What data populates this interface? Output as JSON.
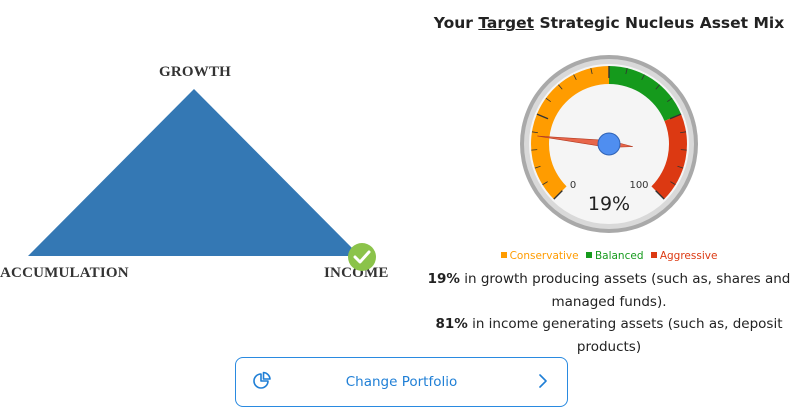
{
  "triangle": {
    "top_label": "GROWTH",
    "left_label": "ACCUMULATION",
    "right_label": "INCOME",
    "fill_color": "#3478b4",
    "selected": "INCOME",
    "check_color": "#8bc34a"
  },
  "title": {
    "prefix": "Your",
    "emphasis": "Target",
    "suffix": "Strategic Nucleus Asset Mix"
  },
  "gauge": {
    "value": 19,
    "display": "19%",
    "min_label": "0",
    "max_label": "100",
    "bands": [
      {
        "name": "Conservative",
        "color": "#ff9c00"
      },
      {
        "name": "Balanced",
        "color": "#159a1c"
      },
      {
        "name": "Aggressive",
        "color": "#dc3912"
      }
    ]
  },
  "legend": [
    {
      "label": "Conservative",
      "color": "#ff9c00"
    },
    {
      "label": "Balanced",
      "color": "#159a1c"
    },
    {
      "label": "Aggressive",
      "color": "#dc3912"
    }
  ],
  "description": {
    "growth_pct": "19%",
    "growth_text": " in growth producing assets (such as, shares and",
    "growth_text2": "managed funds).",
    "income_pct": "81%",
    "income_text": " in income generating assets (such as, deposit products)"
  },
  "change_portfolio": {
    "label": "Change Portfolio",
    "icon": "pie-chart-icon",
    "chevron": "chevron-right-icon"
  }
}
